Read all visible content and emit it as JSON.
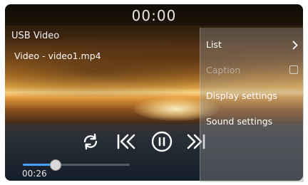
{
  "player": {
    "clock": "00:00",
    "source": "USB Video",
    "filename": "Video - video1.mp4",
    "elapsed": "00:26",
    "progress": 0.3
  },
  "colors": {
    "accent": "#4aa0ff",
    "text": "#ffffff"
  },
  "controls": [
    {
      "name": "repeat-icon"
    },
    {
      "name": "previous-icon"
    },
    {
      "name": "pause-icon"
    },
    {
      "name": "next-icon"
    }
  ],
  "menu": {
    "items": [
      {
        "label": "List",
        "icon": "chevron-right-icon"
      },
      {
        "label": "Caption",
        "icon": "checkbox-icon",
        "disabled": true
      },
      {
        "label": "Display settings"
      },
      {
        "label": "Sound settings"
      }
    ]
  }
}
